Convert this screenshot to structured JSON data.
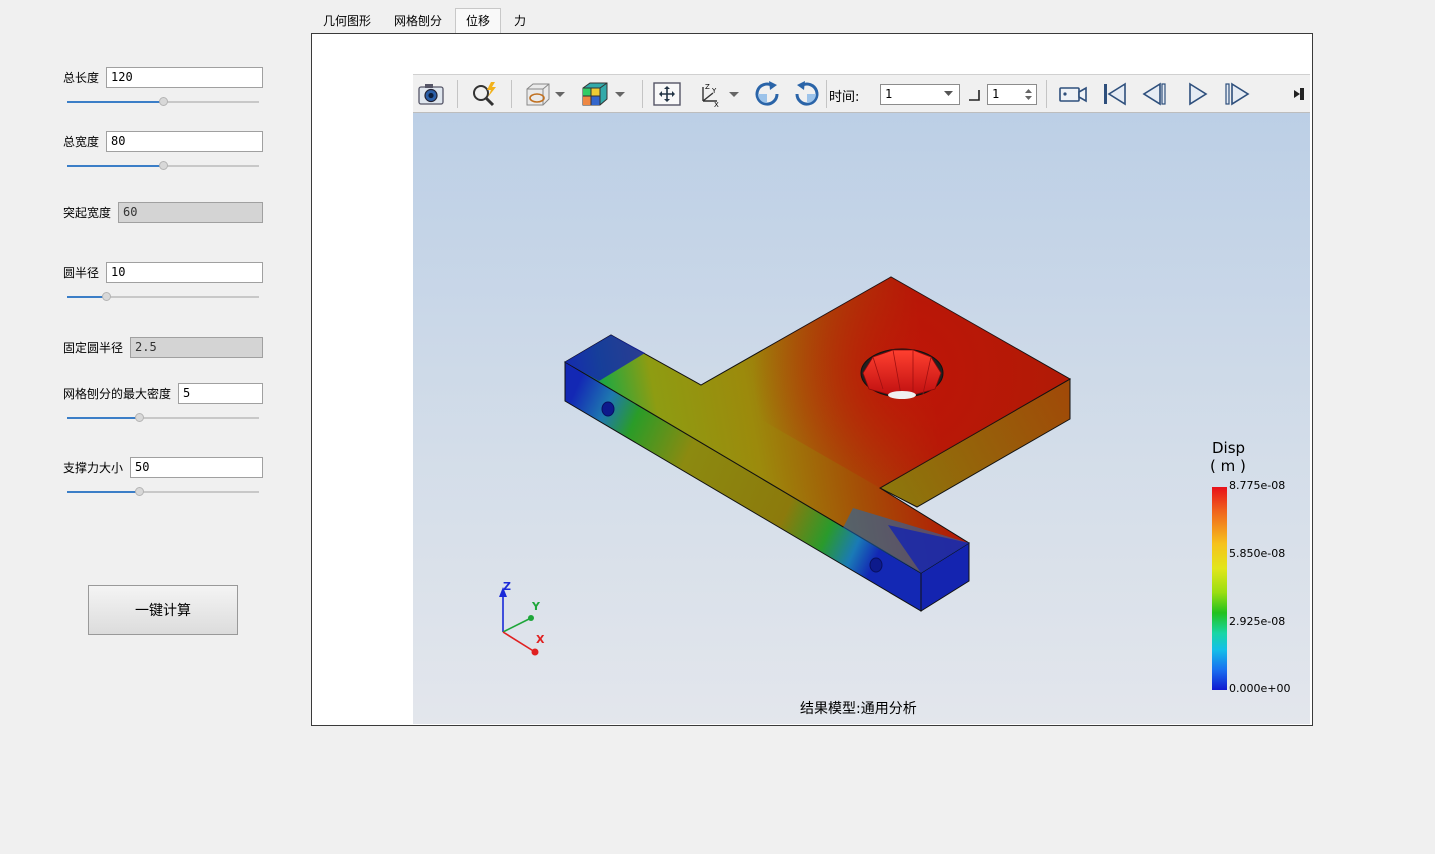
{
  "params": {
    "total_length": {
      "label": "总长度",
      "value": "120",
      "level": 0.5
    },
    "total_width": {
      "label": "总宽度",
      "value": "80",
      "level": 0.5
    },
    "bump_width": {
      "label": "突起宽度",
      "value": "60"
    },
    "circle_radius": {
      "label": "圆半径",
      "value": "10",
      "level": 0.19
    },
    "fixed_radius": {
      "label": "固定圆半径",
      "value": "2.5"
    },
    "mesh_density": {
      "label": "网格刨分的最大密度",
      "value": "5",
      "level": 0.37
    },
    "support_force": {
      "label": "支撑力大小",
      "value": "50",
      "level": 0.37
    }
  },
  "calc_button": "一键计算",
  "tabs": [
    "几何图形",
    "网格刨分",
    "位移",
    "力"
  ],
  "active_tab": 2,
  "toolbar": {
    "time_label": "时间:",
    "time_value": "1",
    "step_value": "1"
  },
  "legend": {
    "title": "Disp",
    "unit": "( m )",
    "ticks": [
      "8.775e-08",
      "5.850e-08",
      "2.925e-08",
      "0.000e+00"
    ]
  },
  "axes": {
    "z": "Z",
    "y": "Y",
    "x": "X"
  },
  "caption": "结果模型:通用分析",
  "colors": {
    "accent": "#3b7ec7",
    "max": "#e8101a",
    "min": "#1018d0"
  }
}
